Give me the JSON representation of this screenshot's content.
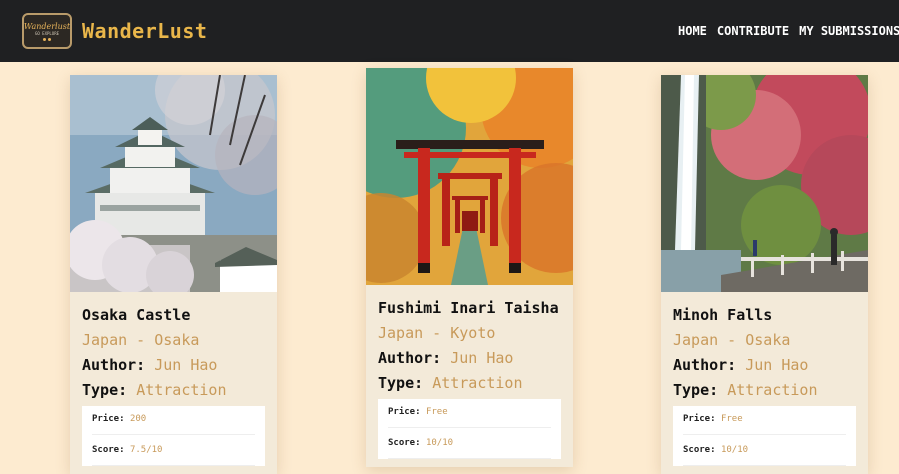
{
  "nav": {
    "logo_text": "Wanderlust",
    "logo_sub": "GO EXPLORE",
    "brand": "WanderLust",
    "links": [
      "HOME",
      "CONTRIBUTE",
      "MY SUBMISSIONS"
    ]
  },
  "cards": [
    {
      "title": "Osaka Castle",
      "location": "Japan - Osaka",
      "author_label": "Author:",
      "author": "Jun Hao",
      "type_label": "Type:",
      "type": "Attraction",
      "price_label": "Price:",
      "price": "200",
      "score_label": "Score:",
      "score": "7.5/10"
    },
    {
      "title": "Fushimi Inari Taisha",
      "location": "Japan - Kyoto",
      "author_label": "Author:",
      "author": "Jun Hao",
      "type_label": "Type:",
      "type": "Attraction",
      "price_label": "Price:",
      "price": "Free",
      "score_label": "Score:",
      "score": "10/10"
    },
    {
      "title": "Minoh Falls",
      "location": "Japan - Osaka",
      "author_label": "Author:",
      "author": "Jun Hao",
      "type_label": "Type:",
      "type": "Attraction",
      "price_label": "Price:",
      "price": "Free",
      "score_label": "Score:",
      "score": "10/10"
    }
  ],
  "colors": {
    "page_bg": "#fdebd0",
    "navbar_bg": "#1f2022",
    "brand": "#e9b64a",
    "accent_text": "#c89a5a",
    "card_bg": "#f3ead9"
  }
}
